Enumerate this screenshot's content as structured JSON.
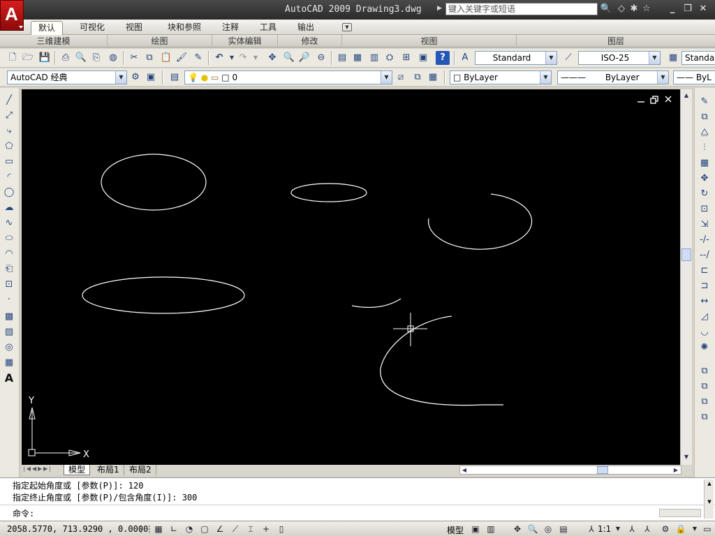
{
  "window": {
    "app_logo": "A",
    "title": "AutoCAD 2009  Drawing3.dwg",
    "search_placeholder": "键入关键字或短语",
    "buttons": [
      "minimize-icon",
      "restore-icon",
      "close-icon"
    ]
  },
  "ribbon": {
    "tabs": [
      "默认",
      "可视化",
      "视图",
      "块和参照",
      "注释",
      "工具",
      "输出"
    ],
    "active_tab": "默认",
    "panels": [
      "三维建模",
      "绘图",
      "实体编辑",
      "修改",
      "视图",
      "图层"
    ]
  },
  "toolbar1": {
    "text_style": "Standard",
    "dim_style": "ISO-25",
    "table_style": "Standar"
  },
  "toolbar2": {
    "workspace": "AutoCAD 经典",
    "layer": "0",
    "color": "ByLayer",
    "linetype": "ByLayer",
    "lineweight": "ByL"
  },
  "drawing": {
    "background": "#000000",
    "stroke": "#ffffff",
    "ucs_x": "X",
    "ucs_y": "Y",
    "view_buttons": [
      "minimize-icon",
      "restore-icon",
      "close-icon"
    ]
  },
  "layout_tabs": [
    "模型",
    "布局1",
    "布局2"
  ],
  "command": {
    "history": [
      "指定起始角度或 [参数(P)]: 120",
      "指定终止角度或 [参数(P)/包含角度(I)]: 300"
    ],
    "prompt": "命令:"
  },
  "status": {
    "coordinates": "2058.5770, 713.9290 , 0.0000",
    "model_label": "模型",
    "scale": "1:1"
  }
}
